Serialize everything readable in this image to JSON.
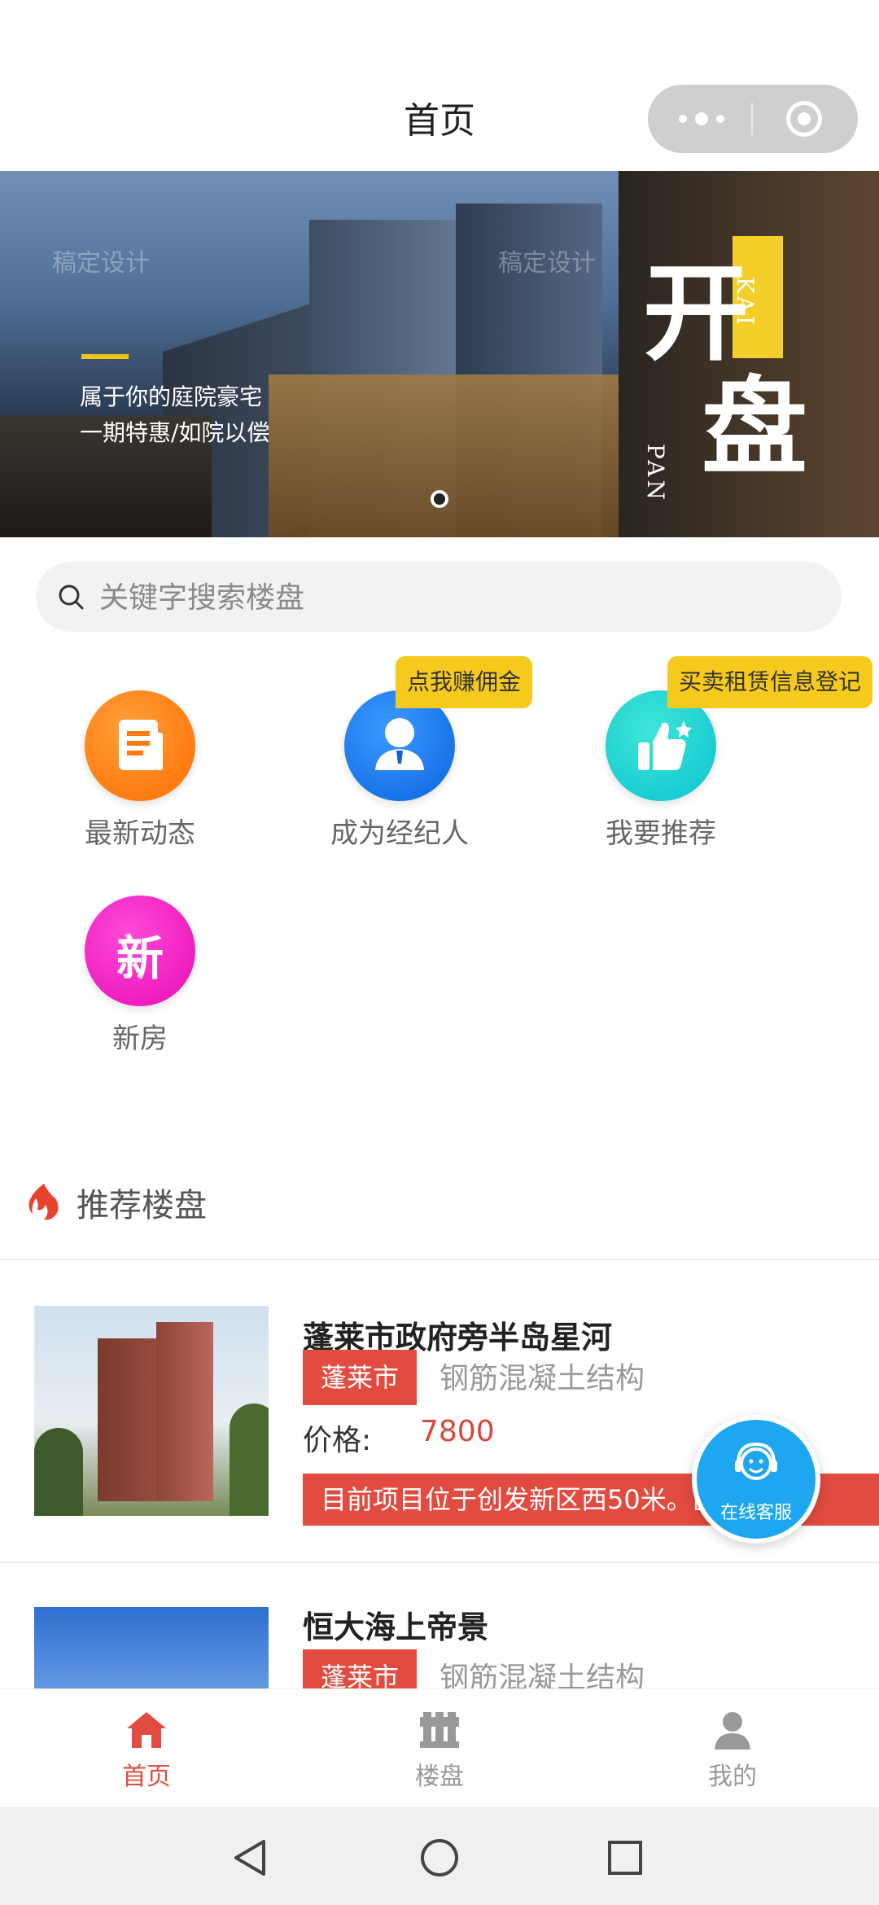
{
  "header": {
    "title": "首页"
  },
  "banner": {
    "watermark_1": "稿定设计",
    "watermark_2": "稿定设计",
    "slogan_line1": "属于你的庭院豪宅",
    "slogan_line2": "一期特惠/如院以偿",
    "big_char_1": "开",
    "big_char_2": "盘",
    "latin_1": "KAI",
    "latin_2": "PAN"
  },
  "search": {
    "placeholder": "关键字搜索楼盘"
  },
  "quick_nav": [
    {
      "label": "最新动态",
      "icon": "news-document-icon",
      "color": "#ff7a12"
    },
    {
      "label": "成为经纪人",
      "icon": "agent-person-icon",
      "color": "#1479f0",
      "badge": "点我赚佣金"
    },
    {
      "label": "我要推荐",
      "icon": "thumbs-up-icon",
      "color": "#12d0d6",
      "badge": "买卖租赁信息登记"
    },
    {
      "label": "新房",
      "icon": "new-house-icon",
      "color": "#f01cc6",
      "glyph": "新"
    }
  ],
  "section": {
    "title": "推荐楼盘"
  },
  "listings": [
    {
      "title": "蓬莱市政府旁半岛星河",
      "city": "蓬莱市",
      "structure": "钢筋混凝土结构",
      "price_label": "价格:",
      "price": "7800",
      "intro": "目前项目位于创发新区西50米。区内公安"
    },
    {
      "title": "恒大海上帝景",
      "city": "蓬莱市",
      "structure": "钢筋混凝土结构"
    }
  ],
  "service": {
    "label": "在线客服"
  },
  "tabbar": [
    {
      "label": "首页",
      "icon": "home-icon",
      "active": true
    },
    {
      "label": "楼盘",
      "icon": "buildings-icon",
      "active": false
    },
    {
      "label": "我的",
      "icon": "profile-icon",
      "active": false
    }
  ],
  "colors": {
    "accent": "#e24b3f",
    "badge": "#f6ca1c",
    "service": "#1ea7f0"
  }
}
